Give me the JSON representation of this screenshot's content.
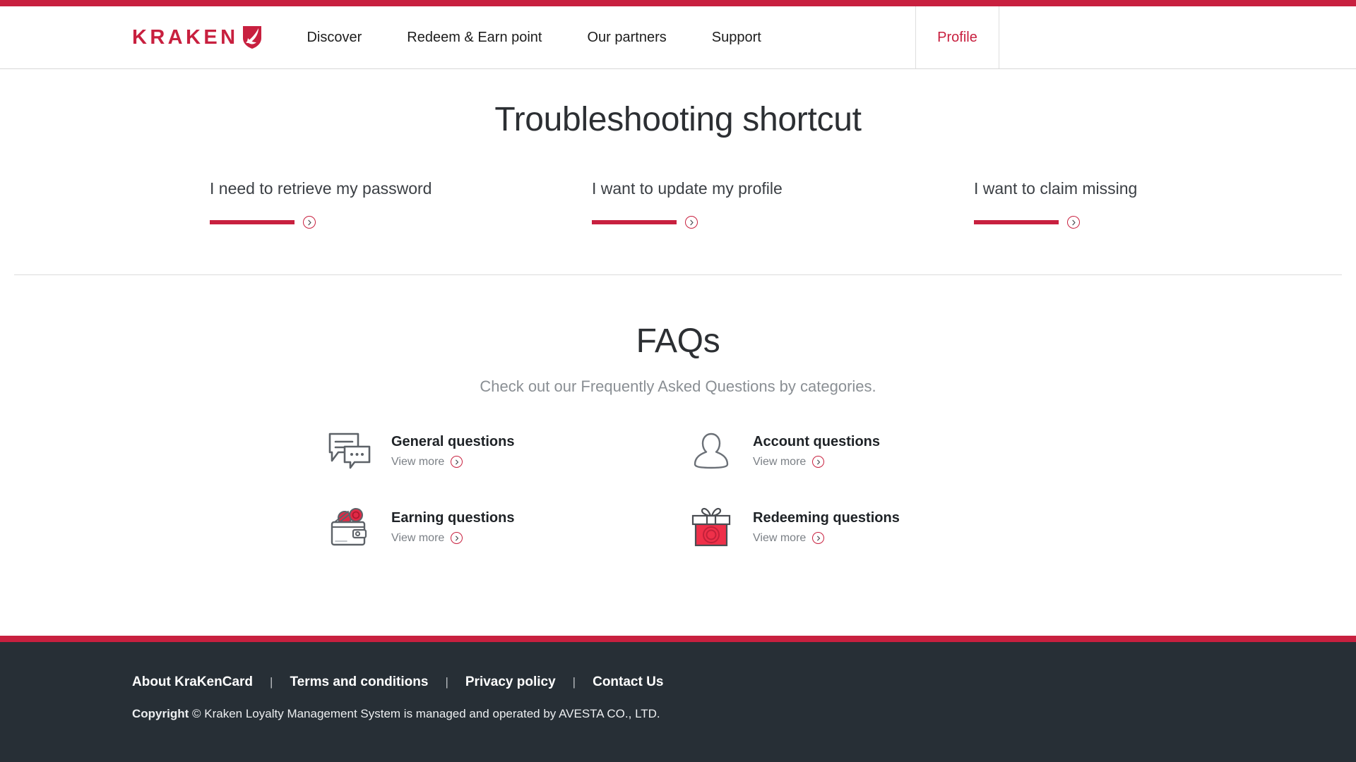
{
  "header": {
    "brand": {
      "word": "KRAKEN",
      "mark_icon": "kraken-shield-icon"
    },
    "nav": [
      {
        "label": "Discover"
      },
      {
        "label": "Redeem & Earn point"
      },
      {
        "label": "Our partners"
      },
      {
        "label": "Support"
      }
    ],
    "profile_label": "Profile"
  },
  "shortcut": {
    "title": "Troubleshooting shortcut",
    "items": [
      {
        "label": "I need to retrieve my password",
        "arrow_icon": "chevron-right-circle-icon"
      },
      {
        "label": "I want to update my profile",
        "arrow_icon": "chevron-right-circle-icon"
      },
      {
        "label": "I want to claim missing",
        "arrow_icon": "chevron-right-circle-icon"
      }
    ]
  },
  "faq": {
    "title": "FAQs",
    "subtitle": "Check out our Frequently Asked Questions by categories.",
    "items": [
      {
        "name": "General questions",
        "more": "View more",
        "icon": "chat-bubbles-icon"
      },
      {
        "name": "Account questions",
        "more": "View more",
        "icon": "person-silhouette-icon"
      },
      {
        "name": "Earning questions",
        "more": "View more",
        "icon": "wallet-coins-icon"
      },
      {
        "name": "Redeeming questions",
        "more": "View more",
        "icon": "gift-box-icon"
      }
    ]
  },
  "footer": {
    "links": [
      {
        "label": "About KraKenCard"
      },
      {
        "label": "Terms and conditions"
      },
      {
        "label": "Privacy policy"
      },
      {
        "label": "Contact Us"
      }
    ],
    "separator": "|",
    "copyright_lead": "Copyright",
    "copyright_rest": "© Kraken Loyalty Management System is managed and operated by AVESTA CO., LTD."
  },
  "colors": {
    "accent": "#c8203f",
    "footer_bg": "#272f36",
    "text": "#2c2f33",
    "muted": "#8a8f94"
  }
}
